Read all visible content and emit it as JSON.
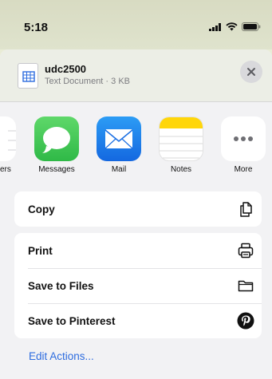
{
  "status_bar": {
    "time": "5:18"
  },
  "share_sheet": {
    "document": {
      "name": "udc2500",
      "subtitle": "Text Document · 3 KB"
    },
    "apps": [
      {
        "label": "ers",
        "icon": "partial-app-icon"
      },
      {
        "label": "Messages",
        "icon": "messages-icon"
      },
      {
        "label": "Mail",
        "icon": "mail-icon"
      },
      {
        "label": "Notes",
        "icon": "notes-icon"
      },
      {
        "label": "More",
        "icon": "more-icon"
      }
    ],
    "group1": [
      {
        "label": "Copy",
        "icon": "copy-icon"
      }
    ],
    "group2": [
      {
        "label": "Print",
        "icon": "printer-icon"
      },
      {
        "label": "Save to Files",
        "icon": "folder-icon"
      },
      {
        "label": "Save to Pinterest",
        "icon": "pinterest-icon"
      }
    ],
    "edit_actions": "Edit Actions..."
  },
  "colors": {
    "accent": "#2d6cdf",
    "messages_green": "#34c759",
    "mail_blue": "#1a73e8",
    "notes_yellow": "#ffd60a"
  }
}
